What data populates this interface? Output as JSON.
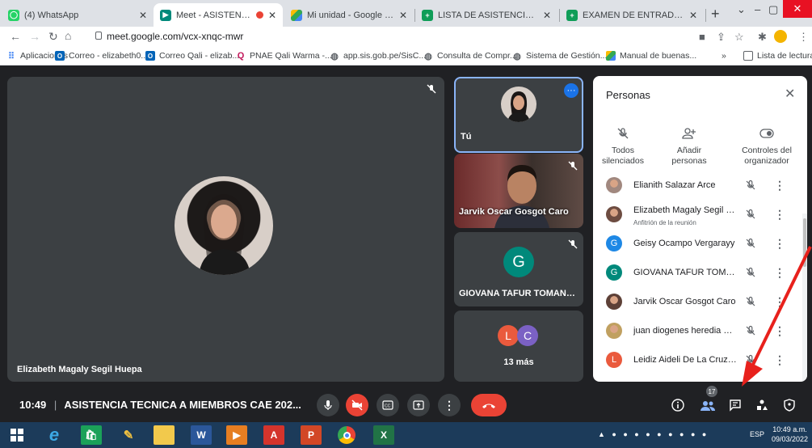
{
  "browser": {
    "tabs": [
      {
        "label": "(4) WhatsApp",
        "icon": "whatsapp-icon",
        "color": "#25d366"
      },
      {
        "label": "Meet - ASISTENCIA TECNI",
        "icon": "meet-icon",
        "color": "#00897b"
      },
      {
        "label": "Mi unidad - Google Drive",
        "icon": "drive-icon",
        "color": "#fbbc04"
      },
      {
        "label": "LISTA DE ASISTENCIA (respues",
        "icon": "forms-icon",
        "color": "#0f9d58"
      },
      {
        "label": "EXAMEN DE ENTRADA (respue",
        "icon": "forms-icon",
        "color": "#0f9d58"
      }
    ],
    "url": "meet.google.com/vcx-xnqc-mwr",
    "bookmarks": [
      {
        "label": "Aplicaciones",
        "icon": "apps-grid-icon"
      },
      {
        "label": "Correo - elizabeth0...",
        "icon": "outlook-icon"
      },
      {
        "label": "Correo Qali - elizab...",
        "icon": "outlook-icon"
      },
      {
        "label": "PNAE Qali Warma -...",
        "icon": "qali-icon"
      },
      {
        "label": "app.sis.gob.pe/SisC...",
        "icon": "globe-icon"
      },
      {
        "label": "Consulta de Compr...",
        "icon": "globe-icon"
      },
      {
        "label": "Sistema de Gestión...",
        "icon": "globe-icon"
      },
      {
        "label": "Manual de buenas...",
        "icon": "drive-icon"
      }
    ],
    "more_bookmarks": "»",
    "reading_list": "Lista de lectura"
  },
  "meet": {
    "main_tile_name": "Elizabeth Magaly Segil Huepa",
    "self_tile_name": "Tú",
    "tiles": [
      {
        "name": "Jarvik Oscar Gosgot Caro"
      },
      {
        "name": "GIOVANA TAFUR TOMANG...",
        "initial": "G",
        "color": "#00897b"
      },
      {
        "name": "13 más",
        "initials": [
          "L",
          "C"
        ],
        "colors": [
          "#ea5a3d",
          "#7b61c4"
        ]
      }
    ],
    "meeting_time": "10:49",
    "meeting_sep": "|",
    "meeting_title": "ASISTENCIA TECNICA A MIEMBROS CAE 202...",
    "participant_count": "17"
  },
  "people_panel": {
    "title": "Personas",
    "controls": [
      {
        "label": "Todos silenciados",
        "icon": "mute-all-icon"
      },
      {
        "label": "Añadir personas",
        "icon": "add-person-icon"
      },
      {
        "label": "Controles del organizador",
        "icon": "host-controls-icon"
      }
    ],
    "people": [
      {
        "name": "Elianith Salazar Arce",
        "sub": "",
        "avatar": "photo",
        "color": "#a1887f"
      },
      {
        "name": "Elizabeth Magaly Segil Hu...",
        "sub": "Anfitrión de la reunión",
        "avatar": "photo",
        "color": "#6d4c41"
      },
      {
        "name": "Geisy Ocampo Vergarayy",
        "sub": "",
        "avatar": "G",
        "color": "#1e88e5"
      },
      {
        "name": "GIOVANA TAFUR TOMAN...",
        "sub": "",
        "avatar": "G",
        "color": "#00897b"
      },
      {
        "name": "Jarvik Oscar Gosgot Caro",
        "sub": "",
        "avatar": "photo",
        "color": "#5d4037"
      },
      {
        "name": "juan diogenes heredia m...",
        "sub": "",
        "avatar": "photo",
        "color": "#c0a060"
      },
      {
        "name": "Leidiz Aideli De La Cruz Cl...",
        "sub": "",
        "avatar": "L",
        "color": "#ea5a3d"
      }
    ]
  },
  "taskbar": {
    "language": "ESP",
    "time": "10:49 a.m.",
    "date": "09/03/2022"
  }
}
